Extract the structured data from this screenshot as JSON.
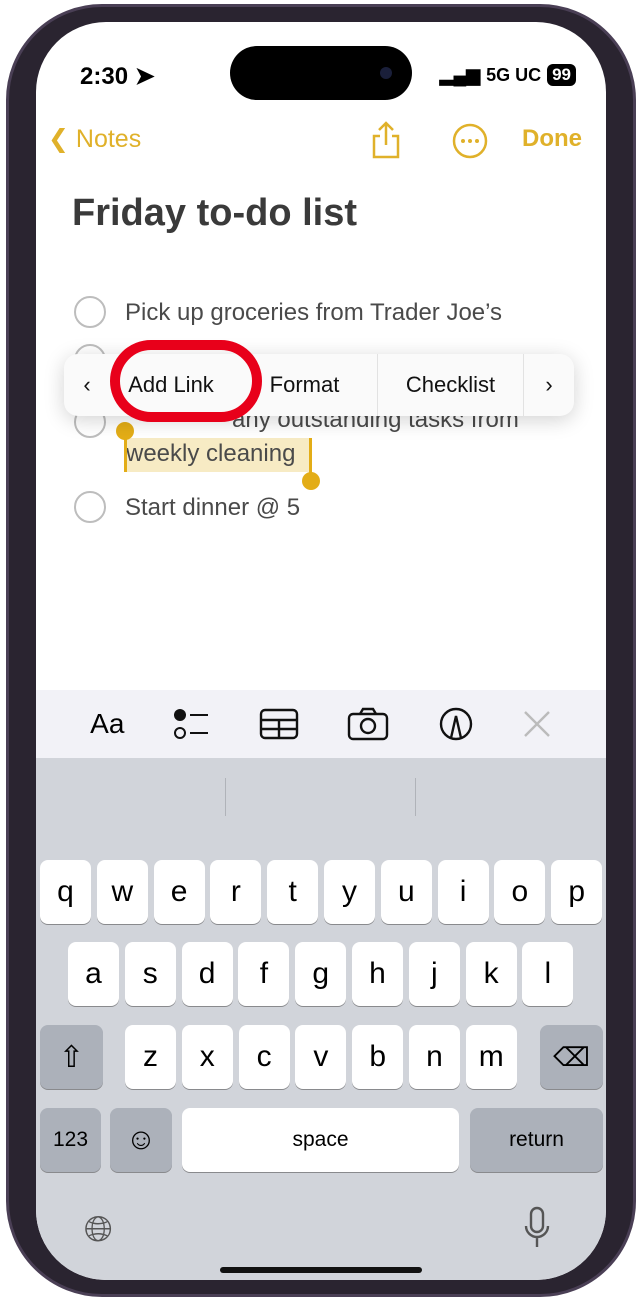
{
  "status": {
    "time": "2:30",
    "network": "5G UC",
    "battery": "99"
  },
  "nav": {
    "back_label": "Notes",
    "done_label": "Done"
  },
  "note": {
    "title": "Friday to-do list",
    "items": [
      {
        "text": "Pick up groceries from Trader Joe’s"
      },
      {
        "text": "any outstanding tasks from",
        "selected_text": "weekly cleaning"
      },
      {
        "text": "Start dinner @ 5"
      }
    ]
  },
  "edit_menu": {
    "items": [
      "Add Link",
      "Format",
      "Checklist"
    ]
  },
  "toolbar": {
    "format_label": "Aa"
  },
  "keyboard": {
    "row1": [
      "q",
      "w",
      "e",
      "r",
      "t",
      "y",
      "u",
      "i",
      "o",
      "p"
    ],
    "row2": [
      "a",
      "s",
      "d",
      "f",
      "g",
      "h",
      "j",
      "k",
      "l"
    ],
    "row3": [
      "z",
      "x",
      "c",
      "v",
      "b",
      "n",
      "m"
    ],
    "numbers": "123",
    "space": "space",
    "return": "return"
  },
  "colors": {
    "accent": "#e0b12a",
    "highlight_ring": "#e8001a",
    "selection": "#f7ebc4"
  }
}
